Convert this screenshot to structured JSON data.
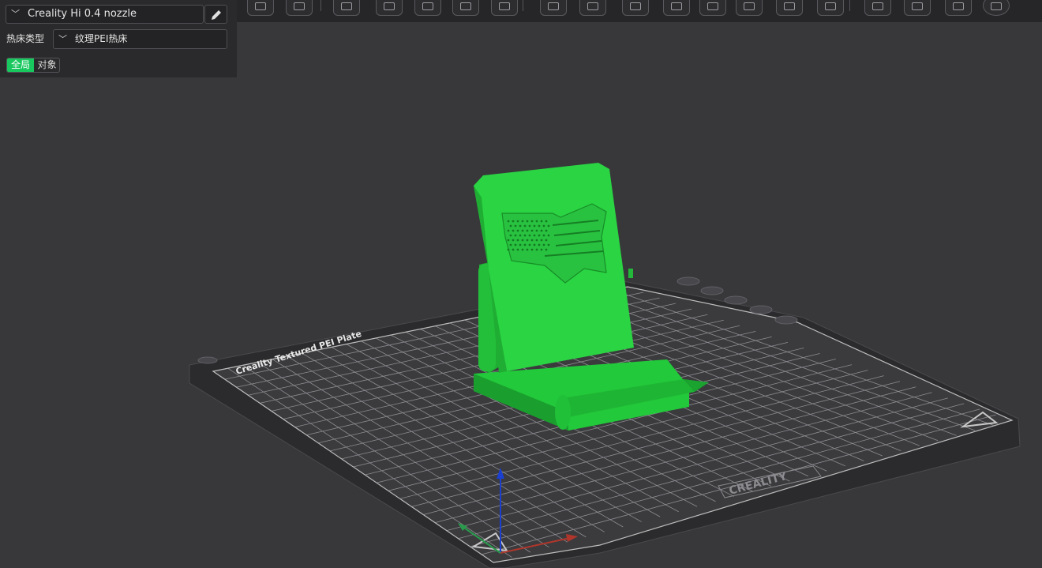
{
  "panel": {
    "printer": {
      "value": "Creality Hi 0.4 nozzle",
      "icon": "chevron-down-icon",
      "edit_icon": "pencil-icon"
    },
    "bed": {
      "label": "热床类型",
      "value": "纹理PEI热床",
      "icon": "chevron-down-icon"
    },
    "scope": {
      "global_label": "全局",
      "object_label": "对象",
      "active": "global"
    }
  },
  "viewport": {
    "plate_name": "Creality Textured PEI Plate",
    "plate_brand": "CREALITY",
    "model_color": "#22c93a",
    "plate_color": "#2a2a2c",
    "grid_color": "#cfcfcf"
  },
  "toolbar": {
    "buttons": [
      "cube-view-icon",
      "grid-icon",
      "move-icon",
      "rotate-icon",
      "layer-slice-icon",
      "arrange-icon",
      "export-icon",
      "split-objects-icon",
      "settings-icon",
      "measure-icon",
      "cube-icon",
      "support-icon",
      "paint-icon",
      "cut-icon",
      "calibration-icon",
      "seam-icon",
      "mesh-boolean-icon",
      "layers-icon",
      "orient-icon",
      "text-icon"
    ]
  },
  "colors": {
    "accent": "#18c75e",
    "axis_x": "#c0392b",
    "axis_y": "#27ae60",
    "axis_z": "#1a3fd1"
  }
}
